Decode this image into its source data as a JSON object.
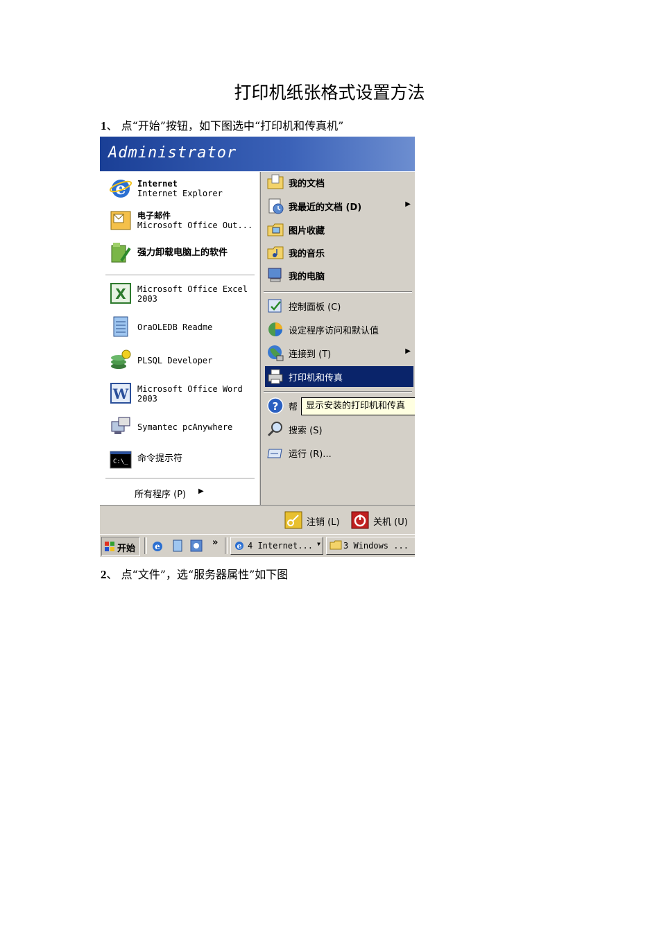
{
  "document": {
    "title": "打印机纸张格式设置方法",
    "step1_num": "1",
    "step1_text": "、 点“开始”按钮，如下图选中“打印机和传真机”",
    "step2_num": "2",
    "step2_text": "、 点“文件”，选“服务器属性”如下图"
  },
  "start_menu": {
    "user": "Administrator",
    "left_items": [
      {
        "line1": "Internet",
        "line2": "Internet Explorer",
        "icon": "ie-icon"
      },
      {
        "line1": "电子邮件",
        "line2": "Microsoft Office Out...",
        "icon": "outlook-icon"
      },
      {
        "line1": "强力卸载电脑上的软件",
        "line2": "",
        "icon": "uninstall-icon"
      },
      {
        "line1": "Microsoft Office Excel",
        "line2": "2003",
        "icon": "excel-icon"
      },
      {
        "line1": "OraOLEDB Readme",
        "line2": "",
        "icon": "notepad-icon"
      },
      {
        "line1": "PLSQL Developer",
        "line2": "",
        "icon": "plsql-icon"
      },
      {
        "line1": "Microsoft Office Word",
        "line2": "2003",
        "icon": "word-icon"
      },
      {
        "line1": "Symantec pcAnywhere",
        "line2": "",
        "icon": "pcanywhere-icon"
      },
      {
        "line1": "命令提示符",
        "line2": "",
        "icon": "cmd-icon"
      }
    ],
    "all_programs": "所有程序 (P)",
    "right_items": [
      {
        "label": "我的文档",
        "icon": "my-documents-icon"
      },
      {
        "label": "我最近的文档 (D)",
        "icon": "recent-documents-icon"
      },
      {
        "label": "图片收藏",
        "icon": "my-pictures-icon"
      },
      {
        "label": "我的音乐",
        "icon": "my-music-icon"
      },
      {
        "label": "我的电脑",
        "icon": "my-computer-icon"
      },
      {
        "label": "控制面板 (C)",
        "icon": "control-panel-icon"
      },
      {
        "label": "设定程序访问和默认值",
        "icon": "program-access-icon"
      },
      {
        "label": "连接到 (T)",
        "icon": "connect-icon"
      },
      {
        "label": "打印机和传真",
        "icon": "printer-icon"
      },
      {
        "label": "帮",
        "icon": "help-icon"
      },
      {
        "label": "搜索 (S)",
        "icon": "search-icon"
      },
      {
        "label": "运行 (R)...",
        "icon": "run-icon"
      }
    ],
    "tooltip": "显示安装的打印机和传真",
    "logoff": "注销 (L)",
    "shutdown": "关机 (U)"
  },
  "taskbar": {
    "start": "开始",
    "quicklaunch_more": "»",
    "task1": "4 Internet...",
    "task2": "3 Windows ..."
  }
}
